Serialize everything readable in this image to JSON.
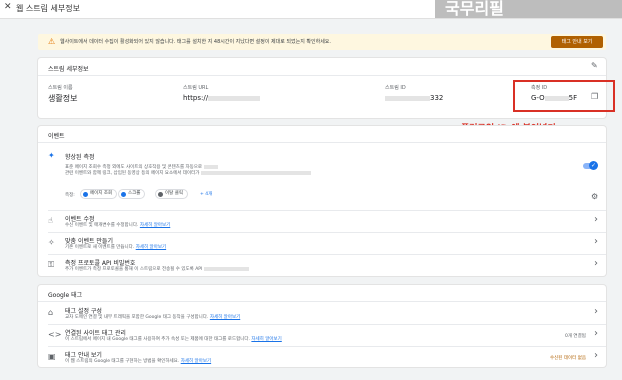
{
  "window": {
    "title": "웹 스트림 세부정보",
    "watermark": "국무리필"
  },
  "banner": {
    "text": "웹사이트에서 데이터 수집이 활성화되어 있지 않습니다. 태그를 설치한 지 48시간이 지났다면 설정이 제대로 되었는지 확인하세요.",
    "button": "태그 안내 보기"
  },
  "stream": {
    "title": "스트림 세부정보",
    "name_label": "스트림 이름",
    "name": "생활정보",
    "url_label": "스트림 URL",
    "url": "https://",
    "id_label": "스트림 ID",
    "id_suffix": "332",
    "mid_label": "측정 ID",
    "mid_prefix": "G-O",
    "mid_suffix": "5F"
  },
  "annotation": "플러그인 ID 에 붙여넣기",
  "events": {
    "title": "이벤트",
    "enhanced": {
      "title": "향상된 측정",
      "desc1": "표준 페이지 조회수 측정 외에도 사이트의 상호작용 및 콘텐츠를 자동으로",
      "desc2": "관련 이벤트와 함께 링크, 삽입된 동영상 등의 페이지 요소에서 데이터가",
      "measure_label": "측정:",
      "chips": [
        "페이지 조회",
        "스크롤",
        "이탈 클릭"
      ],
      "more": "+ 4개"
    },
    "rows": [
      {
        "title": "이벤트 수정",
        "desc": "수신 이벤트 및 매개변수를 수정합니다.",
        "link": "자세히 알아보기"
      },
      {
        "title": "맞춤 이벤트 만들기",
        "desc": "기존 이벤트로 새 이벤트를 만듭니다.",
        "link": "자세히 알아보기"
      },
      {
        "title": "측정 프로토콜 API 비밀번호",
        "desc": "추가 이벤트가 측정 프로토콜을 통해 이 스트림으로 전송될 수 있도록 API",
        "link": ""
      }
    ]
  },
  "google_tag": {
    "title": "Google 태그",
    "rows": [
      {
        "title": "태그 설정 구성",
        "desc": "교차 도메인 연결 및 내부 트래픽을 포함한 Google 태그 동작을 구성합니다.",
        "link": "자세히 알아보기",
        "badge": ""
      },
      {
        "title": "연결된 사이트 태그 관리",
        "desc": "이 스트림에서 페이지 내 Google 태그를 사용하여 추가 속성 또는 제품에 대한 태그를 로드합니다.",
        "link": "자세히 알아보기",
        "badge": "0개 연결됨"
      },
      {
        "title": "태그 안내 보기",
        "desc": "이 웹 스트림의 Google 태그를 구현하는 방법을 확인하세요.",
        "link": "자세히 알아보기",
        "badge": "수신된 데이터 없음"
      }
    ]
  }
}
